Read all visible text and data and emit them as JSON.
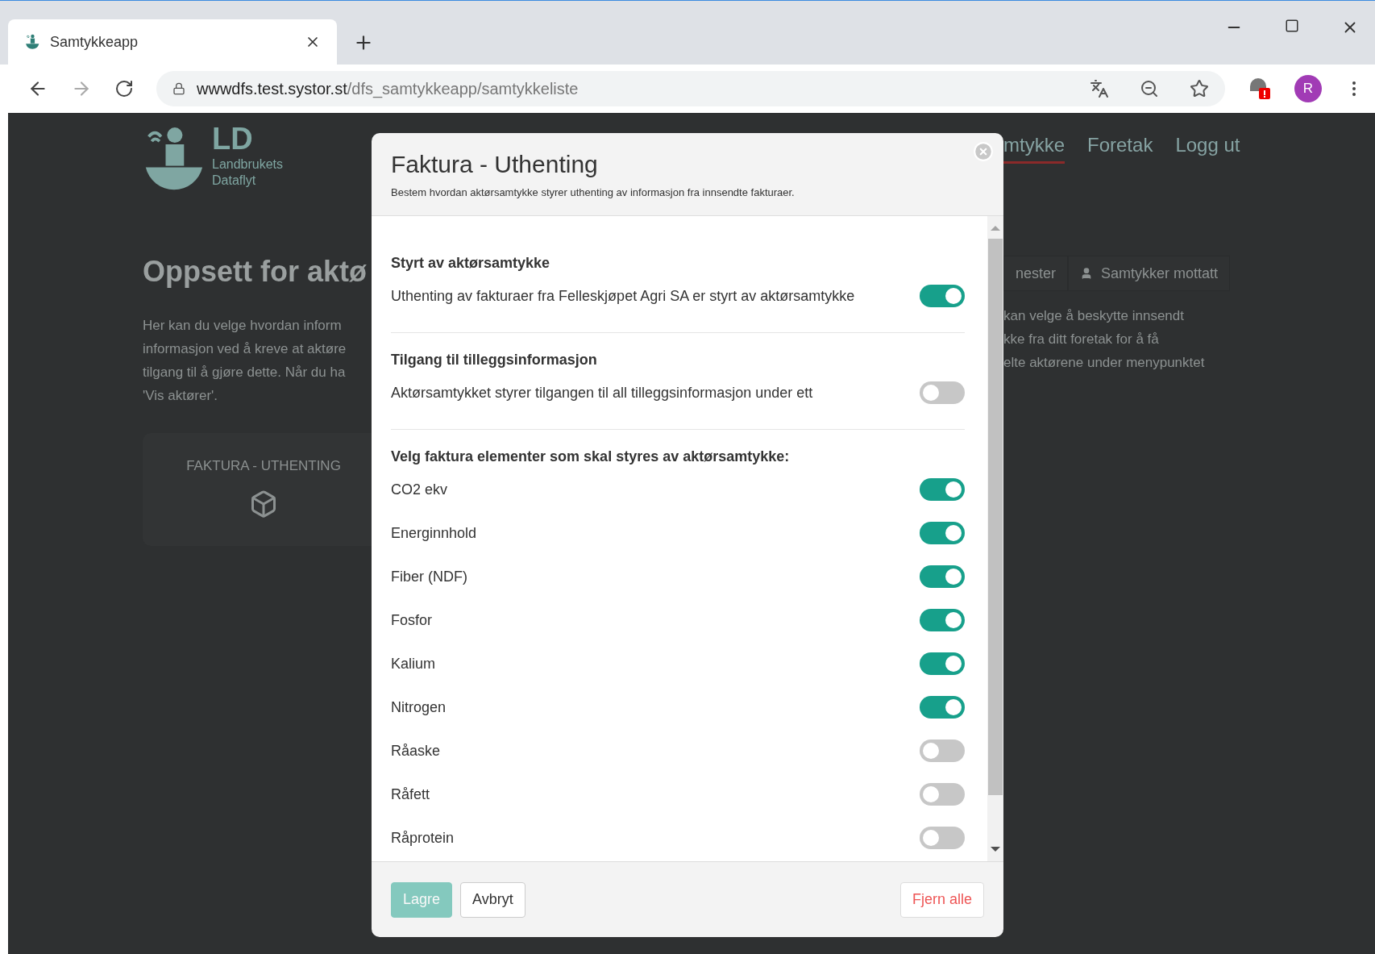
{
  "browser": {
    "tab_title": "Samtykkeapp",
    "url_host": "wwwdfs.test.systor.st",
    "url_path": "/dfs_samtykkeapp/samtykkeliste",
    "profile_initial": "R"
  },
  "background": {
    "logo": {
      "mark": "LD",
      "line1": "Landbrukets",
      "line2": "Dataflyt"
    },
    "nav": [
      {
        "label": "mtykke",
        "selected": true
      },
      {
        "label": "Foretak",
        "selected": false
      },
      {
        "label": "Logg ut",
        "selected": false
      }
    ],
    "heading": "Oppsett for aktø",
    "paragraph_left": [
      "Her kan du velge hvordan inform",
      "informasjon ved å kreve at aktøre",
      "tilgang til å gjøre dette. Når du ha",
      "'Vis aktører'."
    ],
    "paragraph_right": [
      "kan velge å beskytte innsendt",
      "kke fra ditt foretak for å få",
      "elte aktørene under menypunktet"
    ],
    "tabs": [
      {
        "label": "nester",
        "kind": "plain"
      },
      {
        "label": "Samtykker mottatt",
        "kind": "user"
      }
    ],
    "card": {
      "title": "FAKTURA - UTHENTING"
    }
  },
  "modal": {
    "title": "Faktura - Uthenting",
    "subtitle": "Bestem hvordan aktørsamtykke styrer uthenting av informasjon fra innsendte fakturaer.",
    "sections": [
      {
        "heading": "Styrt av aktørsamtykke",
        "items": [
          {
            "label": "Uthenting av fakturaer fra Felleskjøpet Agri SA er styrt av aktørsamtykke",
            "on": true
          }
        ]
      },
      {
        "heading": "Tilgang til tilleggsinformasjon",
        "items": [
          {
            "label": "Aktørsamtykket styrer tilgangen til all tilleggsinformasjon under ett",
            "on": false
          }
        ]
      },
      {
        "heading": "Velg faktura elementer som skal styres av aktørsamtykke:",
        "items": [
          {
            "label": "CO2 ekv",
            "on": true
          },
          {
            "label": "Energinnhold",
            "on": true
          },
          {
            "label": "Fiber (NDF)",
            "on": true
          },
          {
            "label": "Fosfor",
            "on": true
          },
          {
            "label": "Kalium",
            "on": true
          },
          {
            "label": "Nitrogen",
            "on": true
          },
          {
            "label": "Råaske",
            "on": false
          },
          {
            "label": "Råfett",
            "on": false
          },
          {
            "label": "Råprotein",
            "on": false
          }
        ]
      }
    ],
    "buttons": [
      {
        "label": "Lagre",
        "kind": "primary",
        "disabled": true
      },
      {
        "label": "Avbryt",
        "kind": "secondary",
        "disabled": false
      },
      {
        "label": "Fjern alle",
        "kind": "danger",
        "disabled": false
      }
    ]
  }
}
